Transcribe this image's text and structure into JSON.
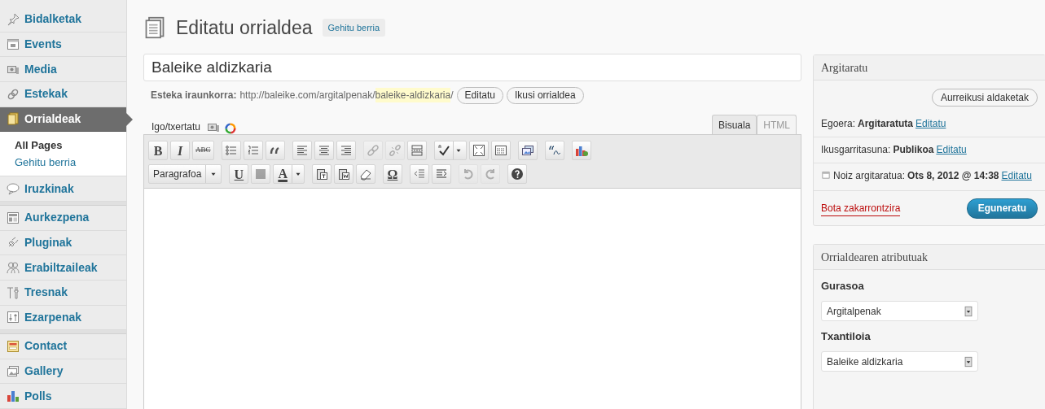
{
  "sidebar": {
    "items": [
      {
        "label": "Bidalketak",
        "selected": false
      },
      {
        "label": "Events",
        "selected": false
      },
      {
        "label": "Media",
        "selected": false
      },
      {
        "label": "Estekak",
        "selected": false
      },
      {
        "label": "Orrialdeak",
        "selected": true,
        "children": [
          {
            "label": "All Pages",
            "selected": true
          },
          {
            "label": "Gehitu berria",
            "selected": false
          }
        ]
      },
      {
        "label": "Iruzkinak",
        "selected": false,
        "separator_after": true
      },
      {
        "label": "Aurkezpena",
        "selected": false
      },
      {
        "label": "Pluginak",
        "selected": false
      },
      {
        "label": "Erabiltzaileak",
        "selected": false
      },
      {
        "label": "Tresnak",
        "selected": false
      },
      {
        "label": "Ezarpenak",
        "selected": false,
        "separator_after": true
      },
      {
        "label": "Contact",
        "selected": false
      },
      {
        "label": "Gallery",
        "selected": false
      },
      {
        "label": "Polls",
        "selected": false
      }
    ]
  },
  "header": {
    "title": "Editatu orrialdea",
    "add_new": "Gehitu berria"
  },
  "post_title": "Baleike aldizkaria",
  "permalink": {
    "label": "Esteka iraunkorra:",
    "base": "http://baleike.com/argitalpenak/",
    "slug": "baleike-aldizkaria",
    "trailing": "/",
    "buttons": [
      "Editatu",
      "Ikusi orrialdea"
    ]
  },
  "upload": {
    "label": "Igo/txertatu"
  },
  "editor_tabs": [
    {
      "label": "Bisuala",
      "selected": true
    },
    {
      "label": "HTML",
      "selected": false
    }
  ],
  "toolbar_rows": [
    [
      {
        "kind": "text",
        "label": "B",
        "disabled": false
      },
      {
        "kind": "text",
        "label": "I",
        "disabled": false
      },
      {
        "kind": "text",
        "label": "ABC",
        "disabled": false
      },
      {
        "kind": "bullets",
        "disabled": false
      },
      {
        "kind": "numbers",
        "disabled": false
      },
      {
        "kind": "quote",
        "disabled": false
      },
      {
        "kind": "align-left",
        "disabled": false
      },
      {
        "kind": "align-center",
        "disabled": false
      },
      {
        "kind": "align-right",
        "disabled": false
      },
      {
        "kind": "link",
        "disabled": true
      },
      {
        "kind": "unlink",
        "disabled": true
      },
      {
        "kind": "more",
        "disabled": false
      },
      {
        "kind": "spell",
        "disabled": false
      },
      {
        "kind": "fullscreen",
        "disabled": false
      },
      {
        "kind": "kitchen",
        "disabled": false
      },
      {
        "kind": "image",
        "disabled": false
      },
      {
        "kind": "quote-plugin",
        "disabled": false
      },
      {
        "kind": "chart",
        "disabled": false
      }
    ],
    [
      {
        "kind": "select",
        "label": "Paragrafoa",
        "disabled": false
      },
      {
        "kind": "text",
        "label": "U",
        "disabled": false
      },
      {
        "kind": "justify",
        "disabled": false
      },
      {
        "kind": "color",
        "label": "A",
        "disabled": false
      },
      {
        "kind": "paste-text",
        "disabled": false
      },
      {
        "kind": "paste-word",
        "disabled": false
      },
      {
        "kind": "eraser",
        "disabled": false
      },
      {
        "kind": "text",
        "label": "Ω",
        "disabled": false
      },
      {
        "kind": "outdent",
        "disabled": false
      },
      {
        "kind": "indent",
        "disabled": false
      },
      {
        "kind": "undo",
        "disabled": true
      },
      {
        "kind": "redo",
        "disabled": true
      },
      {
        "kind": "help",
        "disabled": false
      }
    ]
  ],
  "publish": {
    "title": "Argitaratu",
    "preview": "Aurreikusi aldaketak",
    "rows": [
      {
        "label": "Egoera:",
        "value": "Argitaratuta",
        "link": "Editatu"
      },
      {
        "label": "Ikusgarritasuna:",
        "value": "Publikoa",
        "link": "Editatu"
      },
      {
        "label": "Noiz argitaratua:",
        "value": "Ots 8, 2012 @ 14:38",
        "link": "Editatu",
        "kind": "date"
      }
    ],
    "trash": "Bota zakarrontzira",
    "update": "Eguneratu"
  },
  "attributes": {
    "title": "Orrialdearen atributuak",
    "fields": [
      {
        "label": "Gurasoa",
        "value": "Argitalpenak"
      },
      {
        "label": "Txantiloia",
        "value": "Baleike aldizkaria"
      }
    ]
  }
}
